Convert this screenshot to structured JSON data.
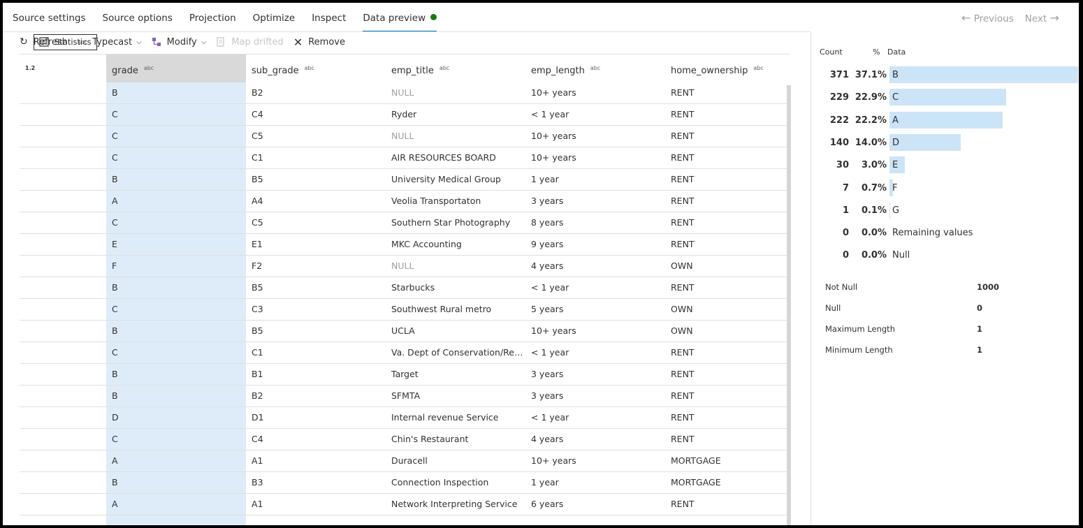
{
  "tabs": [
    {
      "label": "Source settings"
    },
    {
      "label": "Source options"
    },
    {
      "label": "Projection"
    },
    {
      "label": "Optimize"
    },
    {
      "label": "Inspect"
    },
    {
      "label": "Data preview"
    }
  ],
  "pager": {
    "previous": "Previous",
    "next": "Next"
  },
  "toolbar": {
    "refresh": "Refresh",
    "typecast_type": "abc",
    "typecast": "Typecast",
    "modify": "Modify",
    "map_drifted": "Map drifted",
    "statistics": "Statistics",
    "remove": "Remove"
  },
  "grid": {
    "type_label": "1.2",
    "columns": [
      {
        "name": "grade",
        "type": "abc"
      },
      {
        "name": "sub_grade",
        "type": "abc"
      },
      {
        "name": "emp_title",
        "type": "abc"
      },
      {
        "name": "emp_length",
        "type": "abc"
      },
      {
        "name": "home_ownership",
        "type": "abc"
      }
    ],
    "rows": [
      [
        "B",
        "B2",
        "NULL",
        "10+ years",
        "RENT"
      ],
      [
        "C",
        "C4",
        "Ryder",
        "< 1 year",
        "RENT"
      ],
      [
        "C",
        "C5",
        "NULL",
        "10+ years",
        "RENT"
      ],
      [
        "C",
        "C1",
        "AIR RESOURCES BOARD",
        "10+ years",
        "RENT"
      ],
      [
        "B",
        "B5",
        "University Medical Group",
        "1 year",
        "RENT"
      ],
      [
        "A",
        "A4",
        "Veolia Transportaton",
        "3 years",
        "RENT"
      ],
      [
        "C",
        "C5",
        "Southern Star Photography",
        "8 years",
        "RENT"
      ],
      [
        "E",
        "E1",
        "MKC Accounting",
        "9 years",
        "RENT"
      ],
      [
        "F",
        "F2",
        "NULL",
        "4 years",
        "OWN"
      ],
      [
        "B",
        "B5",
        "Starbucks",
        "< 1 year",
        "RENT"
      ],
      [
        "C",
        "C3",
        "Southwest Rural metro",
        "5 years",
        "OWN"
      ],
      [
        "B",
        "B5",
        "UCLA",
        "10+ years",
        "OWN"
      ],
      [
        "C",
        "C1",
        "Va. Dept of Conservation/Rec...",
        "< 1 year",
        "RENT"
      ],
      [
        "B",
        "B1",
        "Target",
        "3 years",
        "RENT"
      ],
      [
        "B",
        "B2",
        "SFMTA",
        "3 years",
        "RENT"
      ],
      [
        "D",
        "D1",
        "Internal revenue Service",
        "< 1 year",
        "RENT"
      ],
      [
        "C",
        "C4",
        "Chin's Restaurant",
        "4 years",
        "RENT"
      ],
      [
        "A",
        "A1",
        "Duracell",
        "10+ years",
        "MORTGAGE"
      ],
      [
        "B",
        "B3",
        "Connection Inspection",
        "1 year",
        "MORTGAGE"
      ],
      [
        "A",
        "A1",
        "Network Interpreting Service",
        "6 years",
        "RENT"
      ]
    ]
  },
  "stats_panel": {
    "headers": {
      "count": "Count",
      "percent": "%",
      "data": "Data"
    },
    "frequencies": [
      {
        "count": "371",
        "percent": "37.1%",
        "label": "B",
        "fraction": 0.371
      },
      {
        "count": "229",
        "percent": "22.9%",
        "label": "C",
        "fraction": 0.229
      },
      {
        "count": "222",
        "percent": "22.2%",
        "label": "A",
        "fraction": 0.222
      },
      {
        "count": "140",
        "percent": "14.0%",
        "label": "D",
        "fraction": 0.14
      },
      {
        "count": "30",
        "percent": "3.0%",
        "label": "E",
        "fraction": 0.03
      },
      {
        "count": "7",
        "percent": "0.7%",
        "label": "F",
        "fraction": 0.007
      },
      {
        "count": "1",
        "percent": "0.1%",
        "label": "G",
        "fraction": 0.001
      },
      {
        "count": "0",
        "percent": "0.0%",
        "label": "Remaining values",
        "fraction": 0
      },
      {
        "count": "0",
        "percent": "0.0%",
        "label": "Null",
        "fraction": 0
      }
    ],
    "summary": [
      {
        "label": "Not Null",
        "value": "1000"
      },
      {
        "label": "Null",
        "value": "0"
      },
      {
        "label": "Maximum Length",
        "value": "1"
      },
      {
        "label": "Minimum Length",
        "value": "1"
      }
    ]
  },
  "colors": {
    "accent": "#0078d4",
    "status_dot": "#107c10",
    "bar": "#cce4f7",
    "selected_column": "#deecf9"
  },
  "icons": [
    "refresh-icon",
    "modify-icon",
    "map-drifted-icon",
    "statistics-icon",
    "remove-icon",
    "chevron-down-icon",
    "arrow-left-icon",
    "arrow-right-icon"
  ]
}
